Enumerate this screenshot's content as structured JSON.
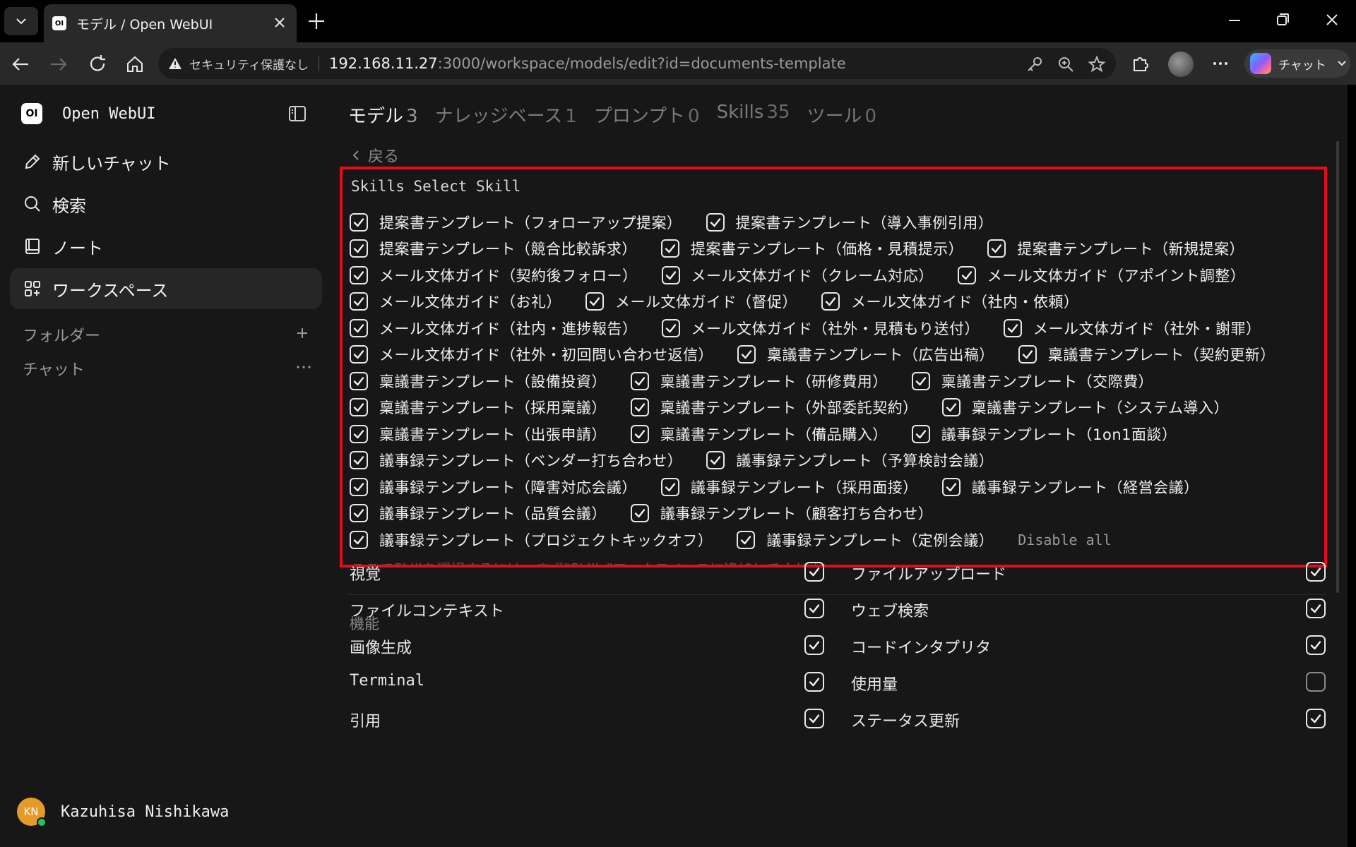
{
  "browser": {
    "tab_title": "モデル / Open WebUI",
    "insecure_label": "セキュリティ保護なし",
    "url_host": "192.168.11.27",
    "url_rest": ":3000/workspace/models/edit?id=documents-template",
    "copilot_label": "チャット"
  },
  "sidebar": {
    "brand": "Open WebUI",
    "brand_logo_text": "OI",
    "items": [
      {
        "label": "新しいチャット",
        "icon": "pencil-icon"
      },
      {
        "label": "検索",
        "icon": "search-icon"
      },
      {
        "label": "ノート",
        "icon": "note-icon"
      },
      {
        "label": "ワークスペース",
        "icon": "grid-icon"
      }
    ],
    "folders_label": "フォルダー",
    "chats_label": "チャット",
    "user": {
      "initials": "KN",
      "name": "Kazuhisa Nishikawa",
      "avatar_color": "#e59a2a",
      "status_color": "#22c55e"
    }
  },
  "workspace_tabs": [
    {
      "label": "モデル",
      "count": "3"
    },
    {
      "label": "ナレッジベース",
      "count": "1"
    },
    {
      "label": "プロンプト",
      "count": "0"
    },
    {
      "label": "Skills",
      "count": "35"
    },
    {
      "label": "ツール",
      "count": "0"
    }
  ],
  "back_label": "戻る",
  "skills": {
    "title": "Skills Select Skill",
    "highlight_color": "#e8091a",
    "rows": [
      [
        "提案書テンプレート（フォローアップ提案）",
        "提案書テンプレート（導入事例引用）"
      ],
      [
        "提案書テンプレート（競合比較訴求）",
        "提案書テンプレート（価格・見積提示）",
        "提案書テンプレート（新規提案）"
      ],
      [
        "メール文体ガイド（契約後フォロー）",
        "メール文体ガイド（クレーム対応）",
        "メール文体ガイド（アポイント調整）"
      ],
      [
        "メール文体ガイド（お礼）",
        "メール文体ガイド（督促）",
        "メール文体ガイド（社内・依頼）"
      ],
      [
        "メール文体ガイド（社内・進捗報告）",
        "メール文体ガイド（社外・見積もり送付）",
        "メール文体ガイド（社外・謝罪）"
      ],
      [
        "メール文体ガイド（社外・初回問い合わせ返信）",
        "稟議書テンプレート（広告出稿）",
        "稟議書テンプレート（契約更新）"
      ],
      [
        "稟議書テンプレート（設備投資）",
        "稟議書テンプレート（研修費用）",
        "稟議書テンプレート（交際費）"
      ],
      [
        "稟議書テンプレート（採用稟議）",
        "稟議書テンプレート（外部委託契約）",
        "稟議書テンプレート（システム導入）"
      ],
      [
        "稟議書テンプレート（出張申請）",
        "稟議書テンプレート（備品購入）",
        "議事録テンプレート（1on1面談）"
      ],
      [
        "議事録テンプレート（ベンダー打ち合わせ）",
        "議事録テンプレート（予算検討会議）"
      ],
      [
        "議事録テンプレート（障害対応会議）",
        "議事録テンプレート（採用面接）",
        "議事録テンプレート（経営会議）"
      ],
      [
        "議事録テンプレート（品質会議）",
        "議事録テンプレート（顧客打ち合わせ）"
      ],
      [
        "議事録テンプレート（プロジェクトキックオフ）",
        "議事録テンプレート（定例会議）"
      ]
    ],
    "disable_all_label": "Disable all",
    "hint": "ここでSkillを選択するには、まず\"Skills\"ワークスペースに追加してください。"
  },
  "features": {
    "title": "機能",
    "left": [
      {
        "label": "視覚",
        "checked": true
      },
      {
        "label": "ファイルコンテキスト",
        "checked": true
      },
      {
        "label": "画像生成",
        "checked": true
      },
      {
        "label": "Terminal",
        "checked": true
      },
      {
        "label": "引用",
        "checked": true
      }
    ],
    "right": [
      {
        "label": "ファイルアップロード",
        "checked": true
      },
      {
        "label": "ウェブ検索",
        "checked": true
      },
      {
        "label": "コードインタプリタ",
        "checked": true
      },
      {
        "label": "使用量",
        "checked": false
      },
      {
        "label": "ステータス更新",
        "checked": true
      }
    ]
  }
}
